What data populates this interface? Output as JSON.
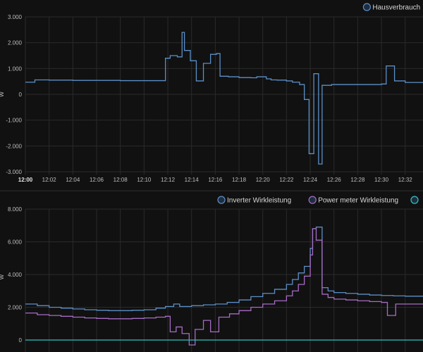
{
  "chart_data": [
    {
      "type": "line",
      "step": true,
      "ylabel": "W",
      "ylim": [
        -3000,
        3000
      ],
      "yticks": [
        3000,
        2000,
        1000,
        0,
        -1000,
        -2000,
        -3000
      ],
      "ytick_labels": [
        "3.000",
        "2.000",
        "1.000",
        "0",
        "-1.000",
        "-2.000",
        "-3.000"
      ],
      "xlim": [
        0,
        33.5
      ],
      "xticks": [
        0,
        2,
        4,
        6,
        8,
        10,
        12,
        14,
        16,
        18,
        20,
        22,
        24,
        26,
        28,
        30,
        32
      ],
      "xtick_labels": [
        "12:00",
        "12:02",
        "12:04",
        "12:06",
        "12:08",
        "12:10",
        "12:12",
        "12:14",
        "12:16",
        "12:18",
        "12:20",
        "12:22",
        "12:24",
        "12:26",
        "12:28",
        "12:30",
        "12:32"
      ],
      "grid": true,
      "legend_position": "top-right",
      "series": [
        {
          "name": "Hausverbrauch",
          "color": "#5b8fc7",
          "x": [
            0,
            0.8,
            2,
            4,
            6,
            8,
            10,
            11.8,
            12.2,
            12.8,
            13.2,
            13.4,
            13.9,
            14.4,
            15,
            15.6,
            16.1,
            16.4,
            17.1,
            18,
            19,
            19.5,
            20.3,
            20.7,
            21.2,
            22,
            22.5,
            23.1,
            23.5,
            23.9,
            24.3,
            24.7,
            25,
            25.8,
            26.5,
            28,
            30,
            30.4,
            31.1,
            32,
            33.5
          ],
          "values": [
            470,
            560,
            550,
            540,
            540,
            530,
            530,
            1400,
            1500,
            1450,
            2400,
            1700,
            1300,
            520,
            1200,
            1550,
            1580,
            700,
            680,
            650,
            640,
            680,
            600,
            560,
            550,
            520,
            470,
            380,
            -200,
            -2300,
            800,
            -2700,
            350,
            380,
            380,
            380,
            400,
            1100,
            520,
            460,
            460
          ]
        }
      ]
    },
    {
      "type": "line",
      "step": true,
      "ylabel": "W",
      "ylim": [
        -300,
        8000
      ],
      "yticks": [
        8000,
        6000,
        4000,
        2000,
        0
      ],
      "ytick_labels": [
        "8.000",
        "6.000",
        "4.000",
        "2.000",
        "0"
      ],
      "xlim": [
        0,
        33.5
      ],
      "grid": true,
      "legend_position": "top-right",
      "series": [
        {
          "name": "Inverter Wirkleistung",
          "color": "#5b8fc7",
          "x": [
            0,
            1,
            2,
            3,
            4,
            5,
            6,
            7,
            8,
            9,
            10,
            11,
            11.8,
            12.5,
            13,
            14,
            15,
            16,
            17,
            18,
            19,
            20,
            21,
            22,
            22.5,
            23,
            23.5,
            24,
            24.2,
            24.5,
            25,
            25.5,
            26,
            27,
            28,
            29,
            30,
            31,
            32,
            33.5
          ],
          "values": [
            2200,
            2100,
            2000,
            1950,
            1900,
            1850,
            1820,
            1800,
            1800,
            1820,
            1850,
            1950,
            2050,
            2200,
            2050,
            2100,
            2150,
            2200,
            2300,
            2450,
            2650,
            2850,
            3100,
            3400,
            3700,
            4100,
            4500,
            5600,
            6800,
            6900,
            3200,
            3000,
            2900,
            2850,
            2800,
            2750,
            2720,
            2700,
            2680,
            2650
          ]
        },
        {
          "name": "Power meter Wirkleistung",
          "color": "#a66cc4",
          "x": [
            0,
            1,
            2,
            3,
            4,
            5,
            6,
            7,
            8,
            9,
            10,
            11,
            11.8,
            12.2,
            12.7,
            13.2,
            13.8,
            14.3,
            15,
            15.6,
            16.3,
            17.2,
            18,
            19,
            20,
            21,
            22,
            22.5,
            23,
            23.5,
            24,
            24.2,
            24.5,
            25,
            25.5,
            26,
            27,
            28,
            29,
            30,
            30.5,
            31.2,
            32,
            33.5
          ],
          "values": [
            1650,
            1550,
            1500,
            1450,
            1400,
            1350,
            1320,
            1300,
            1300,
            1320,
            1350,
            1400,
            1450,
            500,
            800,
            400,
            -300,
            650,
            1200,
            500,
            1400,
            1600,
            1800,
            2000,
            2200,
            2400,
            2700,
            3000,
            3400,
            3900,
            5200,
            6800,
            6100,
            2800,
            2600,
            2500,
            2450,
            2400,
            2350,
            2300,
            1500,
            2200,
            2200,
            2200
          ]
        },
        {
          "name": "",
          "color": "#2ec4c4",
          "x": [
            0,
            33.5
          ],
          "values": [
            0,
            0
          ]
        }
      ]
    }
  ]
}
